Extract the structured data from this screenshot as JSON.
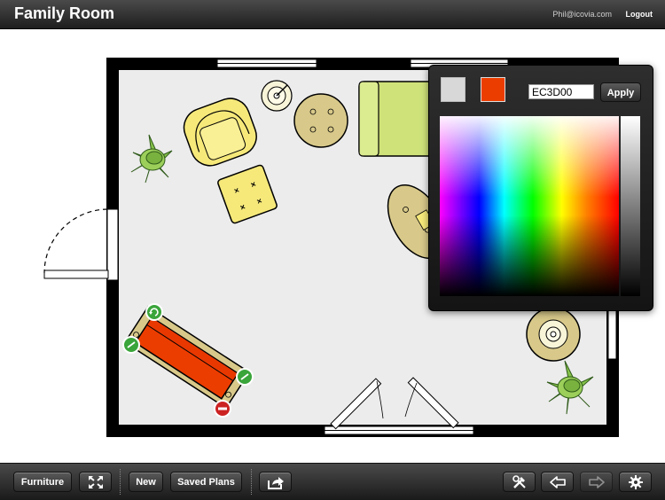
{
  "header": {
    "title": "Family Room",
    "user": "Phil@icovia.com",
    "logout_label": "Logout"
  },
  "toolbar": {
    "furniture_label": "Furniture",
    "new_label": "New",
    "saved_plans_label": "Saved Plans",
    "icons": [
      "fit-to-screen-icon",
      "share-icon",
      "tools-icon",
      "undo-icon",
      "redo-icon",
      "settings-icon"
    ]
  },
  "color_picker": {
    "current_color": "#d8d8d8",
    "selected_color": "#ec3d00",
    "hex_value": "EC3D00",
    "apply_label": "Apply"
  },
  "colors": {
    "wall": "#000000",
    "floor": "#ececec",
    "chair": "#f6e97a",
    "sofa_selected": "#ec3d00",
    "sofa": "#cfe27a",
    "table": "#d8c98a",
    "plant": "#86c24a",
    "handle_green": "#3aa53a",
    "handle_red": "#cc2222"
  }
}
